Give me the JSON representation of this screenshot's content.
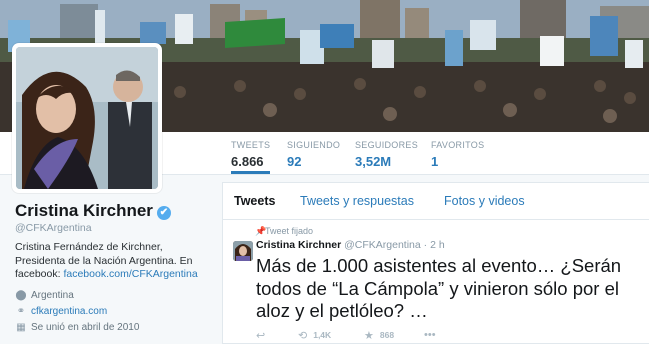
{
  "profile": {
    "name": "Cristina Kirchner",
    "handle": "@CFKArgentina",
    "verified_icon": "verified-badge-icon",
    "bio_line1": "Cristina Fernández de Kirchner,",
    "bio_line2": "Presidenta de la Nación Argentina. En",
    "bio_prefix": "facebook: ",
    "bio_link": "facebook.com/CFKArgentina",
    "location": "Argentina",
    "website": "cfkargentina.com",
    "joined": "Se unió en abril de 2010"
  },
  "stats": [
    {
      "label": "TWEETS",
      "value": "6.866"
    },
    {
      "label": "SIGUIENDO",
      "value": "92"
    },
    {
      "label": "SEGUIDORES",
      "value": "3,52M"
    },
    {
      "label": "FAVORITOS",
      "value": "1"
    }
  ],
  "tabs": [
    "Tweets",
    "Tweets y respuestas",
    "Fotos y videos"
  ],
  "pinned_tweet": {
    "label": "Tweet fijado",
    "author": "Cristina Kirchner",
    "handle": "@CFKArgentina",
    "time": "· 2 h",
    "text": "Más de 1.000 asistentes al evento… ¿Serán todos de “La Cámpola” y vinieron sólo por el aloz y el petlóleo? …",
    "retweets": "1,4K",
    "favorites": "868"
  },
  "colors": {
    "link": "#2b7bb9",
    "verified": "#55acee",
    "muted": "#8899a6",
    "background": "#f5f8fa"
  }
}
